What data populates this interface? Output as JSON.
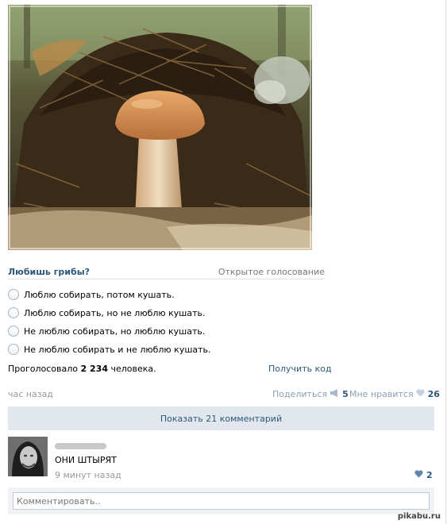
{
  "post": {
    "image_alt": "mushroom under pine needles"
  },
  "poll": {
    "title": "Любишь грибы?",
    "type_label": "Открытое голосование",
    "options": [
      "Люблю собирать, потом кушать.",
      "Люблю собирать, но не люблю кушать.",
      "Не люблю собирать, но люблю кушать.",
      "Не люблю собирать и не люблю кушать."
    ],
    "voted_prefix": "Проголосовало",
    "voted_count": "2 234",
    "voted_suffix": "человека.",
    "get_code_label": "Получить код"
  },
  "meta": {
    "time": "час назад",
    "share_label": "Поделиться",
    "share_count": "5",
    "like_label": "Мне нравится",
    "like_count": "26"
  },
  "comments": {
    "show_label": "Показать 21 комментарий",
    "items": [
      {
        "text": "ОНИ ШТЫРЯТ",
        "time": "9 минут назад",
        "likes": "2"
      }
    ],
    "input_placeholder": "Комментировать.."
  },
  "watermark": "pikabu.ru",
  "colors": {
    "link": "#2b587a",
    "muted": "#999999",
    "button_bg": "#e1e7ed"
  },
  "icons": {
    "share": "megaphone-icon",
    "like": "heart-icon"
  }
}
